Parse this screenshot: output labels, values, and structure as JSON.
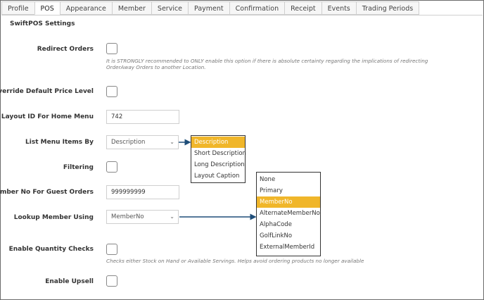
{
  "tabs": [
    "Profile",
    "POS",
    "Appearance",
    "Member",
    "Service",
    "Payment",
    "Confirmation",
    "Receipt",
    "Events",
    "Trading Periods"
  ],
  "active_tab": "POS",
  "section_title": "SwiftPOS Settings",
  "fields": {
    "redirect_orders": {
      "label": "Redirect Orders",
      "hint_line1": "It is STRONGLY recommended to ONLY enable this option if there is absolute certainty regarding the implications of redirecting",
      "hint_line2": "OrderAway Orders to another Location."
    },
    "override_price": {
      "label": "Override Default Price Level"
    },
    "layout_id": {
      "label": "Layout ID For Home Menu",
      "value": "742"
    },
    "list_menu_items": {
      "label": "List Menu Items By",
      "value": "Description",
      "options": [
        "Description",
        "Short Description",
        "Long Description",
        "Layout Caption"
      ],
      "selected_option": "Description"
    },
    "filtering": {
      "label": "Filtering"
    },
    "member_no_guest": {
      "label": "Member No For Guest Orders",
      "value": "999999999"
    },
    "lookup_member": {
      "label": "Lookup Member Using",
      "value": "MemberNo",
      "options": [
        "None",
        "Primary",
        "MemberNo",
        "AlternateMemberNo",
        "AlphaCode",
        "GolfLinkNo",
        "ExternalMemberId"
      ],
      "selected_option": "MemberNo"
    },
    "enable_qty_checks": {
      "label": "Enable Quantity Checks",
      "hint": "Checks either Stock on Hand or Available Servings. Helps avoid ordering products no longer available"
    },
    "enable_upsell": {
      "label": "Enable Upsell"
    }
  },
  "colors": {
    "selected_option_bg": "#f0b62a",
    "arrow": "#1f4e79"
  },
  "icons": {
    "select_chevron": "chevron-down-icon"
  }
}
